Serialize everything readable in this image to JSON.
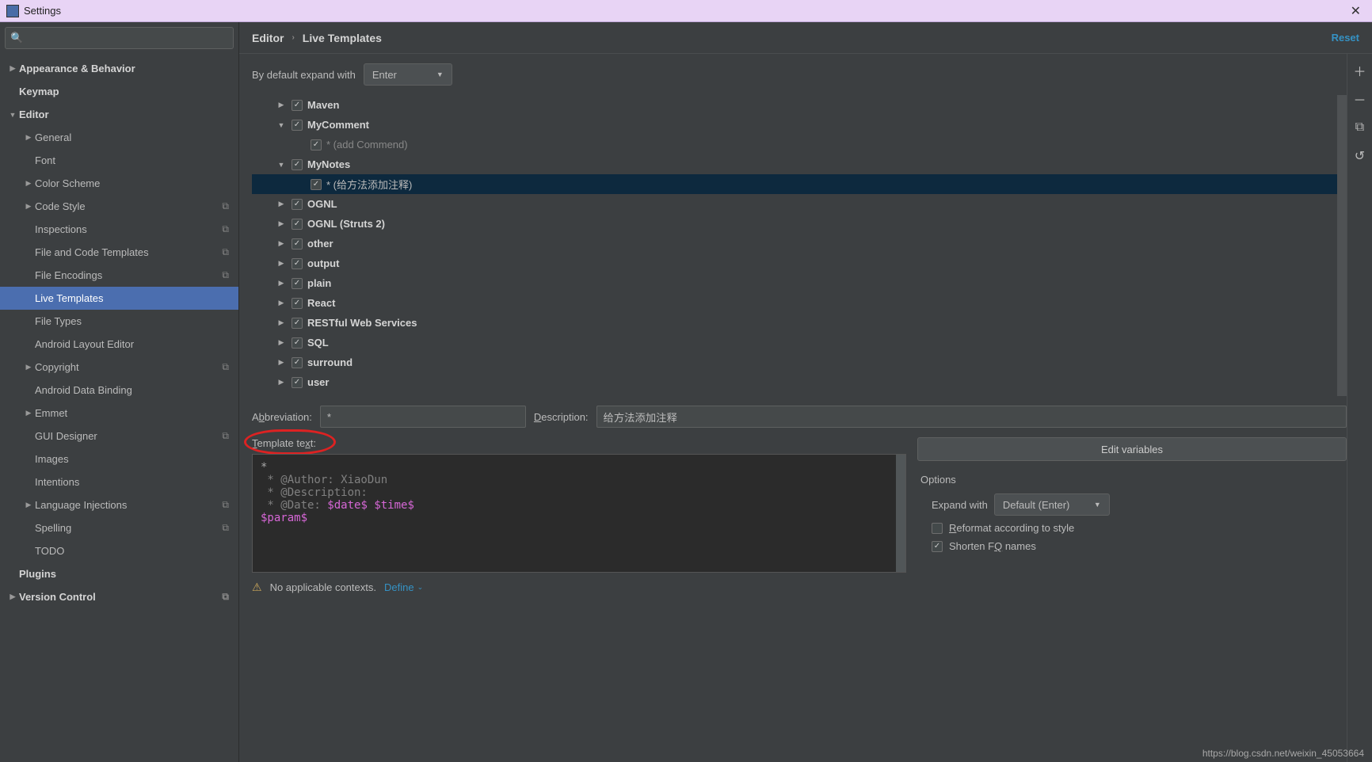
{
  "window_title": "Settings",
  "breadcrumb": {
    "root": "Editor",
    "leaf": "Live Templates"
  },
  "reset_label": "Reset",
  "expand_label": "By default expand with",
  "expand_value": "Enter",
  "sidebar": [
    {
      "label": "Appearance & Behavior",
      "bold": true,
      "arrow": "right",
      "level": 0
    },
    {
      "label": "Keymap",
      "bold": true,
      "arrow": "",
      "level": 0
    },
    {
      "label": "Editor",
      "bold": true,
      "arrow": "down",
      "level": 0
    },
    {
      "label": "General",
      "bold": false,
      "arrow": "right",
      "level": 1
    },
    {
      "label": "Font",
      "bold": false,
      "arrow": "",
      "level": 1
    },
    {
      "label": "Color Scheme",
      "bold": false,
      "arrow": "right",
      "level": 1
    },
    {
      "label": "Code Style",
      "bold": false,
      "arrow": "right",
      "level": 1,
      "copy": true
    },
    {
      "label": "Inspections",
      "bold": false,
      "arrow": "",
      "level": 1,
      "copy": true
    },
    {
      "label": "File and Code Templates",
      "bold": false,
      "arrow": "",
      "level": 1,
      "copy": true
    },
    {
      "label": "File Encodings",
      "bold": false,
      "arrow": "",
      "level": 1,
      "copy": true
    },
    {
      "label": "Live Templates",
      "bold": false,
      "arrow": "",
      "level": 1,
      "selected": true
    },
    {
      "label": "File Types",
      "bold": false,
      "arrow": "",
      "level": 1
    },
    {
      "label": "Android Layout Editor",
      "bold": false,
      "arrow": "",
      "level": 1
    },
    {
      "label": "Copyright",
      "bold": false,
      "arrow": "right",
      "level": 1,
      "copy": true
    },
    {
      "label": "Android Data Binding",
      "bold": false,
      "arrow": "",
      "level": 1
    },
    {
      "label": "Emmet",
      "bold": false,
      "arrow": "right",
      "level": 1
    },
    {
      "label": "GUI Designer",
      "bold": false,
      "arrow": "",
      "level": 1,
      "copy": true
    },
    {
      "label": "Images",
      "bold": false,
      "arrow": "",
      "level": 1
    },
    {
      "label": "Intentions",
      "bold": false,
      "arrow": "",
      "level": 1
    },
    {
      "label": "Language Injections",
      "bold": false,
      "arrow": "right",
      "level": 1,
      "copy": true
    },
    {
      "label": "Spelling",
      "bold": false,
      "arrow": "",
      "level": 1,
      "copy": true
    },
    {
      "label": "TODO",
      "bold": false,
      "arrow": "",
      "level": 1
    },
    {
      "label": "Plugins",
      "bold": true,
      "arrow": "",
      "level": 0
    },
    {
      "label": "Version Control",
      "bold": true,
      "arrow": "right",
      "level": 0,
      "copy": true
    }
  ],
  "templates": [
    {
      "label": "Maven",
      "arrow": "right",
      "checked": true,
      "level": 1
    },
    {
      "label": "MyComment",
      "arrow": "down",
      "checked": true,
      "level": 1
    },
    {
      "label": "* (add Commend)",
      "arrow": "",
      "checked": true,
      "level": 2,
      "sub": true
    },
    {
      "label": "MyNotes",
      "arrow": "down",
      "checked": true,
      "level": 1
    },
    {
      "label": "* (给方法添加注释)",
      "arrow": "",
      "checked": true,
      "level": 2,
      "sub": true,
      "selected": true
    },
    {
      "label": "OGNL",
      "arrow": "right",
      "checked": true,
      "level": 1
    },
    {
      "label": "OGNL (Struts 2)",
      "arrow": "right",
      "checked": true,
      "level": 1
    },
    {
      "label": "other",
      "arrow": "right",
      "checked": true,
      "level": 1
    },
    {
      "label": "output",
      "arrow": "right",
      "checked": true,
      "level": 1
    },
    {
      "label": "plain",
      "arrow": "right",
      "checked": true,
      "level": 1
    },
    {
      "label": "React",
      "arrow": "right",
      "checked": true,
      "level": 1
    },
    {
      "label": "RESTful Web Services",
      "arrow": "right",
      "checked": true,
      "level": 1
    },
    {
      "label": "SQL",
      "arrow": "right",
      "checked": true,
      "level": 1
    },
    {
      "label": "surround",
      "arrow": "right",
      "checked": true,
      "level": 1
    },
    {
      "label": "user",
      "arrow": "right",
      "checked": true,
      "level": 1
    }
  ],
  "abbr_label": "Abbreviation:",
  "abbr_value": "*",
  "desc_label": "Description:",
  "desc_value": "给方法添加注释",
  "template_text_label": "Template text:",
  "editor_lines": {
    "l0": "*",
    "l1": " * @Author: XiaoDun",
    "l2": " * @Description:",
    "l3_pre": " * @Date: ",
    "l3_v1": "$date$",
    "l3_sp": " ",
    "l3_v2": "$time$",
    "l4": "$param$"
  },
  "edit_vars_label": "Edit variables",
  "options_title": "Options",
  "expand_with_label": "Expand with",
  "expand_with_value": "Default (Enter)",
  "reformat_label": "Reformat according to style",
  "shorten_label": "Shorten FQ names",
  "context_text": "No applicable contexts.",
  "define_label": "Define",
  "watermark": "https://blog.csdn.net/weixin_45053664"
}
